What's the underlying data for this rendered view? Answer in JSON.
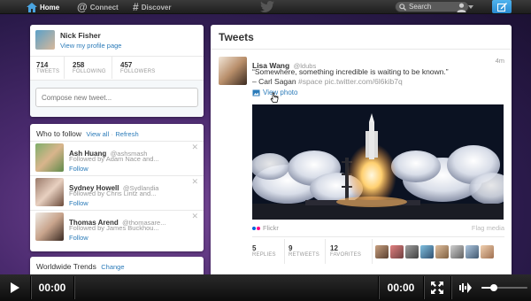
{
  "nav": {
    "home_label": "Home",
    "connect_label": "Connect",
    "discover_label": "Discover",
    "search_placeholder": "Search"
  },
  "profile": {
    "name": "Nick Fisher",
    "view_profile_link": "View my profile page",
    "stats": [
      {
        "value": "714",
        "label": "TWEETS"
      },
      {
        "value": "258",
        "label": "FOLLOWING"
      },
      {
        "value": "457",
        "label": "FOLLOWERS"
      }
    ],
    "compose_placeholder": "Compose new tweet..."
  },
  "who_to_follow": {
    "title": "Who to follow",
    "view_all": "View all",
    "separator": "·",
    "refresh": "Refresh",
    "items": [
      {
        "name": "Ash Huang",
        "handle": "@ashsmash",
        "followed_by": "Followed by Adam Nace and...",
        "follow_label": "Follow"
      },
      {
        "name": "Sydney Howell",
        "handle": "@Sydlandia",
        "followed_by": "Followed by Chris Lintz and...",
        "follow_label": "Follow"
      },
      {
        "name": "Thomas Arend",
        "handle": "@thomasare...",
        "followed_by": "Followed by James Buckhou...",
        "follow_label": "Follow"
      }
    ]
  },
  "trends": {
    "title": "Worldwide Trends",
    "change": "Change"
  },
  "tweets": {
    "title": "Tweets",
    "tweet": {
      "name": "Lisa Wang",
      "handle": "@ldubs",
      "time": "4m",
      "line1": "“Somewhere, something incredible is waiting to be known.”",
      "line2_author": "– Carl Sagan",
      "line2_hashtag": "#space",
      "line2_link": "pic.twitter.com/6l6kib7q",
      "view_photo": "View photo",
      "photo_source": "Flickr",
      "flag_media": "Flag media",
      "retweets_stats": [
        {
          "value": "5",
          "label": "REPLIES"
        },
        {
          "value": "9",
          "label": "RETWEETS"
        },
        {
          "value": "12",
          "label": "FAVORITES"
        }
      ]
    }
  },
  "video": {
    "current_time": "00:00",
    "duration": "00:00"
  }
}
